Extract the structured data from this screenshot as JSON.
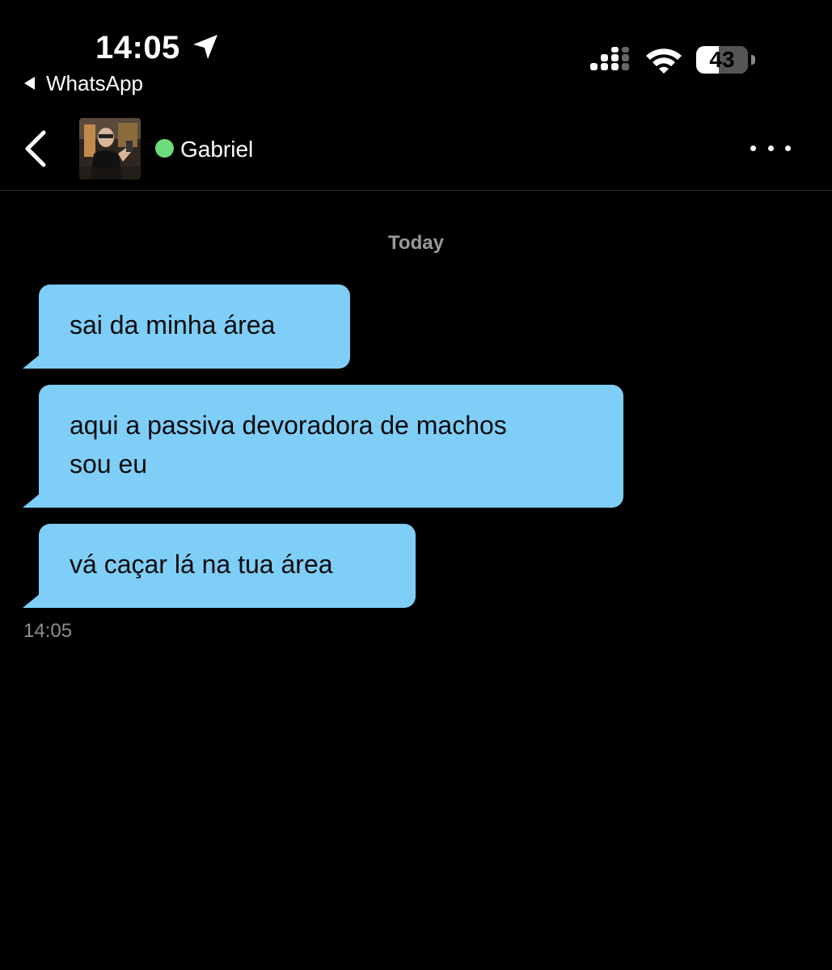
{
  "status_bar": {
    "time": "14:05",
    "back_app": "WhatsApp",
    "battery_level": "43",
    "battery_fraction": 0.43,
    "icons": [
      "location-arrow-icon",
      "signal-icon",
      "wifi-icon",
      "battery-icon"
    ]
  },
  "chat": {
    "contact_name": "Gabriel",
    "online": true,
    "online_color": "#6cdc7c",
    "icons": [
      "chevron-left-icon",
      "more-options-icon"
    ]
  },
  "messages": {
    "date_separator": "Today",
    "bubble_color": "#7ecef8",
    "items": [
      {
        "text": "sai da minha área"
      },
      {
        "text": "aqui a passiva devoradora de machos\nsou eu"
      },
      {
        "text": "vá caçar lá na tua área"
      }
    ],
    "timestamp": "14:05"
  }
}
